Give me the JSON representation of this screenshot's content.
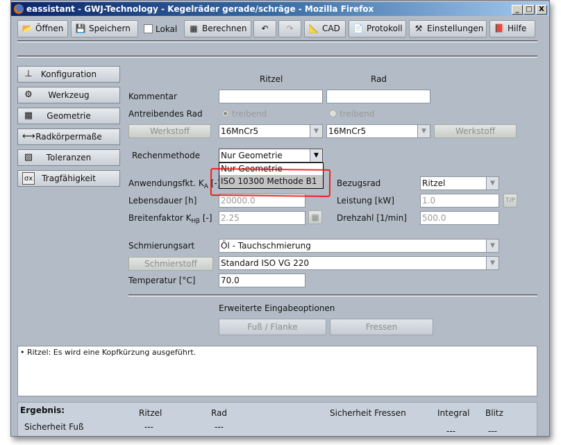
{
  "window": {
    "title": "eassistant - GWJ-Technology - Kegelräder gerade/schräge - Mozilla Firefox",
    "controls": [
      "_",
      "□",
      "X"
    ]
  },
  "toolbar": {
    "open": "Öffnen",
    "save": "Speichern",
    "local": "Lokal",
    "local_checked": false,
    "calculate": "Berechnen",
    "cad": "CAD",
    "protocol": "Protokoll",
    "settings": "Einstellungen",
    "help": "Hilfe"
  },
  "sidebar": {
    "items": [
      {
        "label": "Konfiguration",
        "icon": "configuration-icon"
      },
      {
        "label": "Werkzeug",
        "icon": "tool-icon"
      },
      {
        "label": "Geometrie",
        "icon": "geometry-icon"
      },
      {
        "label": "Radkörpermaße",
        "icon": "dimensions-icon"
      },
      {
        "label": "Toleranzen",
        "icon": "tolerances-icon"
      },
      {
        "label": "Tragfähigkeit",
        "icon": "load-capacity-icon"
      }
    ]
  },
  "form": {
    "col_pinion": "Ritzel",
    "col_gear": "Rad",
    "comment_label": "Kommentar",
    "comment_pinion": "",
    "comment_gear": "",
    "driving_label": "Antreibendes Rad",
    "driving_pinion": "treibend",
    "driving_gear": "treibend",
    "driving_selected": "pinion",
    "material_button": "Werkstoff",
    "material_pinion": "16MnCr5",
    "material_gear": "16MnCr5",
    "method_label": "Rechenmethode",
    "method_value": "Nur Geometrie",
    "method_options": [
      "Nur Geometrie",
      "ISO 10300 Methode B1"
    ],
    "method_highlighted": "ISO 10300 Methode B1",
    "ka_label": "Anwendungsfkt. K",
    "ka_sub": "A",
    "ka_unit": " [-]",
    "life_label": "Lebensdauer [h]",
    "life_value": "20000.0",
    "khb_label": "Breitenfaktor K",
    "khb_sub": "Hβ",
    "khb_unit": " [-]",
    "khb_value": "2.25",
    "ref_label": "Bezugsrad",
    "ref_value": "Ritzel",
    "power_label": "Leistung [kW]",
    "power_value": "1.0",
    "tp_button": "T/P",
    "speed_label": "Drehzahl [1/min]",
    "speed_value": "500.0",
    "lube_label": "Schmierungsart",
    "lube_value": "Öl - Tauchschmierung",
    "lubricant_button": "Schmierstoff",
    "lubricant_value": "Standard ISO VG 220",
    "temp_label": "Temperatur [°C]",
    "temp_value": "70.0",
    "extended_label": "Erweiterte Eingabeoptionen",
    "root_flank_button": "Fuß / Flanke",
    "scuffing_button": "Fressen"
  },
  "messages": [
    "• Ritzel: Es wird eine Kopfkürzung ausgeführt."
  ],
  "results": {
    "title": "Ergebnis:",
    "col_pinion": "Ritzel",
    "col_gear": "Rad",
    "scuffing": "Sicherheit Fressen",
    "integral": "Integral",
    "flash": "Blitz",
    "row_root": "Sicherheit Fuß",
    "root_pinion": "---",
    "root_gear": "---",
    "integral_value": "---",
    "flash_value": "---"
  },
  "colors": {
    "background": "#b3bcc6",
    "titlebar": "#0a246a",
    "annotation": "#ff0000"
  }
}
